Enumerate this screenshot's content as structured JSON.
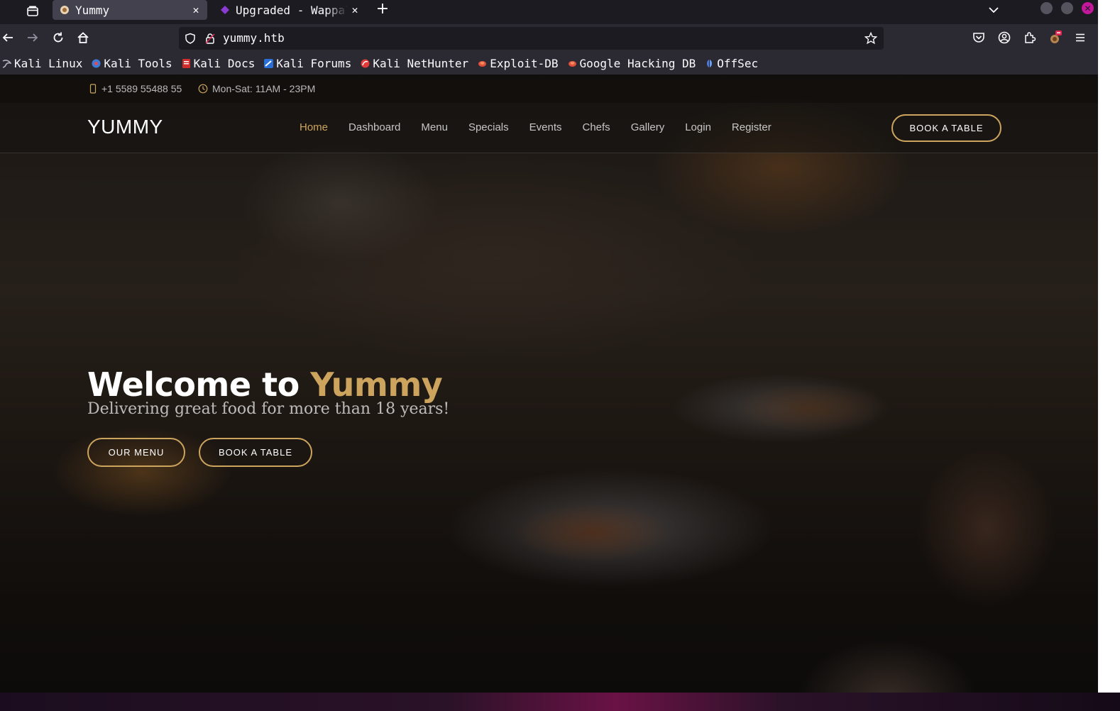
{
  "browser": {
    "tabs": [
      {
        "title": "Yummy",
        "active": true
      },
      {
        "title": "Upgraded - Wappal",
        "active": false
      }
    ],
    "new_tab": "+",
    "url": "yummy.htb",
    "bookmarks": [
      {
        "label": "Kali Linux",
        "icon": "kali-dragon-icon"
      },
      {
        "label": "Kali Tools",
        "icon": "kali-tools-icon"
      },
      {
        "label": "Kali Docs",
        "icon": "kali-docs-icon"
      },
      {
        "label": "Kali Forums",
        "icon": "kali-forums-icon"
      },
      {
        "label": "Kali NetHunter",
        "icon": "nethunter-icon"
      },
      {
        "label": "Exploit-DB",
        "icon": "exploit-db-icon"
      },
      {
        "label": "Google Hacking DB",
        "icon": "ghdb-icon"
      },
      {
        "label": "OffSec",
        "icon": "offsec-icon"
      }
    ]
  },
  "site": {
    "topbar": {
      "phone": "+1 5589 55488 55",
      "hours": "Mon-Sat: 11AM - 23PM"
    },
    "logo": "YUMMY",
    "nav": [
      "Home",
      "Dashboard",
      "Menu",
      "Specials",
      "Events",
      "Chefs",
      "Gallery",
      "Login",
      "Register"
    ],
    "nav_active": "Home",
    "book_button": "BOOK A TABLE",
    "hero": {
      "title_prefix": "Welcome to ",
      "title_accent": "Yummy",
      "subtitle": "Delivering great food for more than 18 years!",
      "cta_menu": "OUR MENU",
      "cta_book": "BOOK A TABLE"
    },
    "accent_color": "#cda45e"
  }
}
